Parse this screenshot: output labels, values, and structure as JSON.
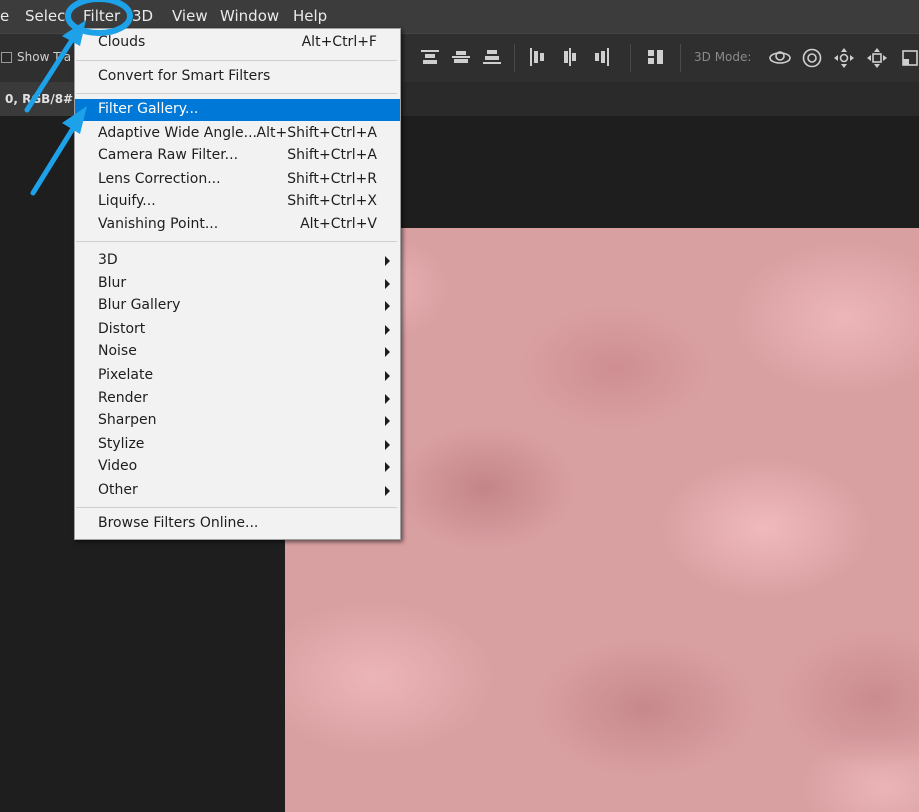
{
  "menubar": {
    "items": [
      "e",
      "Select",
      "Filter",
      "3D",
      "View",
      "Window",
      "Help"
    ]
  },
  "options_bar": {
    "show_transform_label": "Show Tra",
    "mode_label": "3D Mode:"
  },
  "document_tab": {
    "label": "0, RGB/8#)"
  },
  "filter_menu": {
    "top_items": [
      {
        "label": "Clouds",
        "shortcut": "Alt+Ctrl+F"
      },
      {
        "label": "Convert for Smart Filters",
        "shortcut": ""
      }
    ],
    "filter_items": [
      {
        "label": "Filter Gallery...",
        "shortcut": ""
      },
      {
        "label": "Adaptive Wide Angle...",
        "shortcut": "Alt+Shift+Ctrl+A"
      },
      {
        "label": "Camera Raw Filter...",
        "shortcut": "Shift+Ctrl+A"
      },
      {
        "label": "Lens Correction...",
        "shortcut": "Shift+Ctrl+R"
      },
      {
        "label": "Liquify...",
        "shortcut": "Shift+Ctrl+X"
      },
      {
        "label": "Vanishing Point...",
        "shortcut": "Alt+Ctrl+V"
      }
    ],
    "submenus": [
      "3D",
      "Blur",
      "Blur Gallery",
      "Distort",
      "Noise",
      "Pixelate",
      "Render",
      "Sharpen",
      "Stylize",
      "Video",
      "Other"
    ],
    "bottom_item": "Browse Filters Online...",
    "highlighted": "Filter Gallery..."
  },
  "colors": {
    "highlight": "#0078d7",
    "annotation": "#1da1e8",
    "canvas": "#d9a0a2"
  },
  "icons": [
    "align-icon",
    "3d-orbit-icon",
    "3d-roll-icon",
    "3d-drag-icon",
    "3d-slide-icon",
    "3d-scale-icon"
  ]
}
